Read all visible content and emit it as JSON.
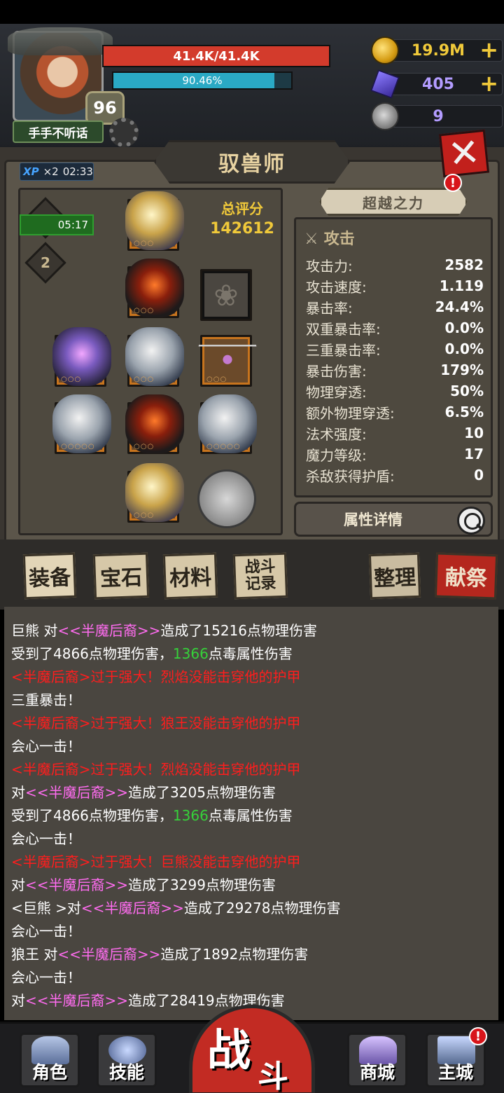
{
  "player": {
    "name": "手手不听话",
    "level": "96",
    "hp_text": "41.4K/41.4K",
    "hp_fraction": 1.0,
    "xp_text": "90.46%",
    "xp_fraction": 0.9046
  },
  "resources": {
    "gold": "19.9M",
    "gems": "405",
    "skulls": "9",
    "plus": "+"
  },
  "panel": {
    "title": "驭兽师",
    "close": "✕",
    "xp_boost": {
      "label": "XP",
      "mult": "×2",
      "timer": "02:33"
    },
    "buff_timer": "05:17",
    "rank": "2",
    "score_label": "总评分",
    "score_value": "142612",
    "beyond_button": "超越之力",
    "alert": "!"
  },
  "stats": {
    "header": "攻击",
    "rows": [
      {
        "k": "攻击力:",
        "v": "2582"
      },
      {
        "k": "攻击速度:",
        "v": "1.119"
      },
      {
        "k": "暴击率:",
        "v": "24.4%"
      },
      {
        "k": "双重暴击率:",
        "v": "0.0%"
      },
      {
        "k": "三重暴击率:",
        "v": "0.0%"
      },
      {
        "k": "暴击伤害:",
        "v": "179%"
      },
      {
        "k": "物理穿透:",
        "v": "50%"
      },
      {
        "k": "额外物理穿透:",
        "v": "6.5%"
      },
      {
        "k": "法术强度:",
        "v": "10"
      },
      {
        "k": "魔力等级:",
        "v": "17"
      },
      {
        "k": "杀敌获得护盾:",
        "v": "0"
      }
    ],
    "detail_button": "属性详情"
  },
  "tabs": {
    "equipment": "装备",
    "gems": "宝石",
    "materials": "材料",
    "record_line1": "战斗",
    "record_line2": "记录",
    "sort": "整理",
    "sacrifice": "献祭"
  },
  "log": [
    [
      {
        "t": "巨熊 对"
      },
      {
        "t": "<<半魔后裔>>",
        "c": "pink"
      },
      {
        "t": "造成了15216点物理伤害"
      }
    ],
    [
      {
        "t": "受到了4866点物理伤害，"
      },
      {
        "t": "1366",
        "c": "green"
      },
      {
        "t": "点毒属性伤害"
      }
    ],
    [
      {
        "t": "<半魔后裔>过于强大！烈焰没能击穿他的护甲",
        "c": "red"
      }
    ],
    [
      {
        "t": "三重暴击！"
      }
    ],
    [
      {
        "t": "<半魔后裔>过于强大！狼王没能击穿他的护甲",
        "c": "red"
      }
    ],
    [
      {
        "t": "会心一击！"
      }
    ],
    [
      {
        "t": "<半魔后裔>过于强大！烈焰没能击穿他的护甲",
        "c": "red"
      }
    ],
    [
      {
        "t": "对"
      },
      {
        "t": "<<半魔后裔>>",
        "c": "pink"
      },
      {
        "t": "造成了3205点物理伤害"
      }
    ],
    [
      {
        "t": "受到了4866点物理伤害，"
      },
      {
        "t": "1366",
        "c": "green"
      },
      {
        "t": "点毒属性伤害"
      }
    ],
    [
      {
        "t": "会心一击！"
      }
    ],
    [
      {
        "t": "<半魔后裔>过于强大！巨熊没能击穿他的护甲",
        "c": "red"
      }
    ],
    [
      {
        "t": "对"
      },
      {
        "t": "<<半魔后裔>>",
        "c": "pink"
      },
      {
        "t": "造成了3299点物理伤害"
      }
    ],
    [
      {
        "t": "<巨熊 >对"
      },
      {
        "t": "<<半魔后裔>>",
        "c": "pink"
      },
      {
        "t": "造成了29278点物理伤害"
      }
    ],
    [
      {
        "t": "会心一击！"
      }
    ],
    [
      {
        "t": "狼王 对"
      },
      {
        "t": "<<半魔后裔>>",
        "c": "pink"
      },
      {
        "t": "造成了1892点物理伤害"
      }
    ],
    [
      {
        "t": "会心一击！"
      }
    ],
    [
      {
        "t": "对"
      },
      {
        "t": "<<半魔后裔>>",
        "c": "pink"
      },
      {
        "t": "造成了28419点物理伤害"
      }
    ]
  ],
  "nav": {
    "character": "角色",
    "skills": "技能",
    "battle_1": "战",
    "battle_2": "斗",
    "shop": "商城",
    "castle": "主城",
    "alert": "!"
  }
}
